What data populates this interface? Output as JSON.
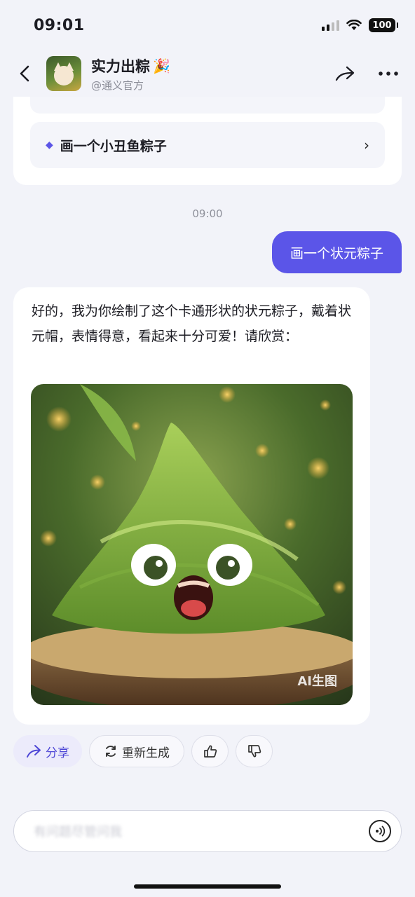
{
  "status": {
    "time": "09:01",
    "battery": "100"
  },
  "header": {
    "name": "实力出粽",
    "party_emoji": "🎉",
    "subtitle": "@通义官方"
  },
  "suggestion": {
    "label": "画一个小丑鱼粽子"
  },
  "chat": {
    "timestamp": "09:00",
    "user_message": "画一个状元粽子",
    "bot_message": "好的，我为你绘制了这个卡通形状的状元粽子，戴着状元帽，表情得意，看起来十分可爱！请欣赏：",
    "image_watermark": "AI生图"
  },
  "actions": {
    "share": "分享",
    "regenerate": "重新生成"
  },
  "input": {
    "placeholder": "有问题尽管问我"
  },
  "colors": {
    "accent": "#5b55e8",
    "background": "#f2f3f9"
  }
}
